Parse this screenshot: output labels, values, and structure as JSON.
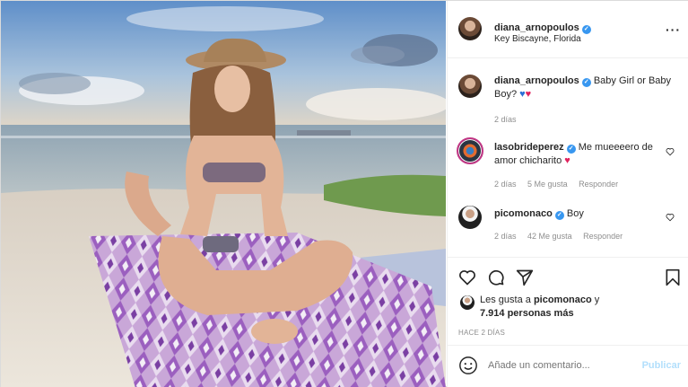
{
  "post": {
    "author": "diana_arnopoulos",
    "location": "Key Biscayne, Florida"
  },
  "caption": {
    "username": "diana_arnopoulos",
    "text": "Baby Girl or Baby Boy?",
    "emojis": [
      "blue-heart",
      "red-heart"
    ],
    "age": "2 días"
  },
  "comments": [
    {
      "username": "lasobrideperez",
      "text": "Me mueeeero de amor chicharito",
      "emoji": "red-heart",
      "age": "2 días",
      "likes": "5 Me gusta",
      "reply": "Responder"
    },
    {
      "username": "picomonaco",
      "text": "Boy",
      "age": "2 días",
      "likes": "42 Me gusta",
      "reply": "Responder"
    }
  ],
  "likes": {
    "prefix": "Les gusta a",
    "user": "picomonaco",
    "suffix": "y",
    "others": "7.914 personas más"
  },
  "timestamp": "HACE 2 DÍAS",
  "composer": {
    "placeholder": "Añade un comentario...",
    "post_label": "Publicar"
  },
  "colors": {
    "verified": "#3897f0",
    "post_button": "#b2dffc",
    "blue_heart": "#2b6fd6",
    "red_heart": "#e0245e"
  }
}
